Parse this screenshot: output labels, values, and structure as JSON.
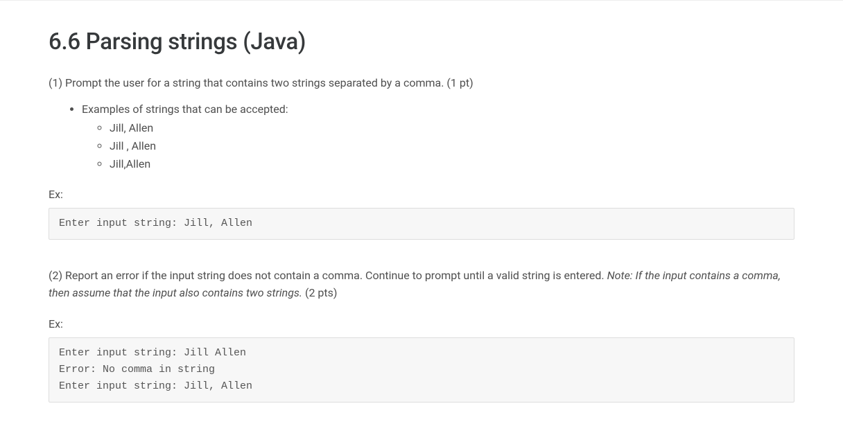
{
  "title": "6.6 Parsing strings (Java)",
  "section1": {
    "prompt": "(1) Prompt the user for a string that contains two strings separated by a comma. (1 pt)",
    "examples_label": "Examples of strings that can be accepted:",
    "examples": {
      "e1": "Jill, Allen",
      "e2": "Jill , Allen",
      "e3": "Jill,Allen"
    },
    "ex_label": "Ex:",
    "code": "Enter input string: Jill, Allen"
  },
  "section2": {
    "prompt_plain": "(2) Report an error if the input string does not contain a comma. Continue to prompt until a valid string is entered. ",
    "prompt_note": "Note: If the input contains a comma, then assume that the input also contains two strings.",
    "prompt_tail": " (2 pts)",
    "ex_label": "Ex:",
    "code": "Enter input string: Jill Allen\nError: No comma in string\nEnter input string: Jill, Allen"
  }
}
